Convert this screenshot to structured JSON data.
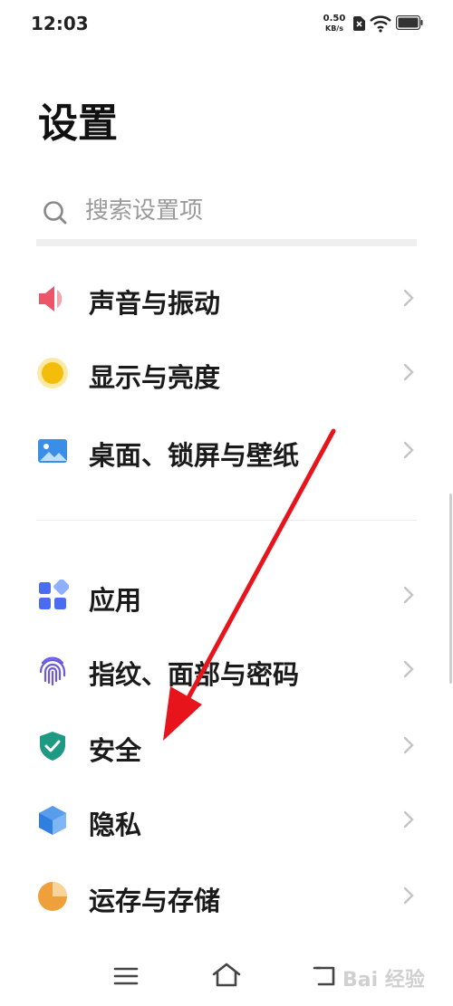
{
  "status_bar": {
    "time": "12:03",
    "net_speed_value": "0.50",
    "net_speed_unit": "KB/s"
  },
  "page": {
    "title": "设置"
  },
  "search": {
    "placeholder": "搜索设置项"
  },
  "settings_items": [
    {
      "label": "声音与振动",
      "icon": "speaker-icon",
      "color": "#ec5467"
    },
    {
      "label": "显示与亮度",
      "icon": "brightness-icon",
      "color": "#f5bd0b"
    },
    {
      "label": "桌面、锁屏与壁纸",
      "icon": "wallpaper-icon",
      "color": "#3a8ee6"
    },
    {
      "label": "应用",
      "icon": "apps-icon",
      "color": "#4a6cf0"
    },
    {
      "label": "指纹、面部与密码",
      "icon": "fingerprint-icon",
      "color": "#6a5ae0"
    },
    {
      "label": "安全",
      "icon": "shield-icon",
      "color": "#1e9a82"
    },
    {
      "label": "隐私",
      "icon": "privacy-cube-icon",
      "color": "#2e7fe0"
    },
    {
      "label": "运存与存储",
      "icon": "storage-pie-icon",
      "color": "#f0a03a"
    }
  ],
  "nav_bar": {
    "menu_icon": "menu-icon",
    "home_icon": "home-icon",
    "back_icon": "back-icon"
  },
  "watermark": {
    "text": "Bai 经验"
  },
  "annotation": {
    "color": "#e8141c"
  }
}
